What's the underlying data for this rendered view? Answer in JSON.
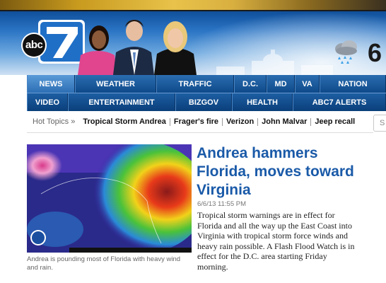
{
  "brand": {
    "logo_text": "abc",
    "logo_number": "7"
  },
  "weather": {
    "icon": "rain-cloud-icon",
    "temperature": "6"
  },
  "nav_primary": [
    {
      "label": "NEWS",
      "active": true
    },
    {
      "label": "WEATHER"
    },
    {
      "label": "TRAFFIC"
    },
    {
      "label": "D.C."
    },
    {
      "label": "MD"
    },
    {
      "label": "VA"
    },
    {
      "label": "NATION"
    }
  ],
  "nav_secondary": [
    {
      "label": "VIDEO"
    },
    {
      "label": "ENTERTAINMENT"
    },
    {
      "label": "BIZGOV"
    },
    {
      "label": "HEALTH"
    },
    {
      "label": "ABC7 ALERTS"
    }
  ],
  "hot_topics": {
    "label": "Hot Topics »",
    "items": [
      "Tropical Storm Andrea",
      "Frager's fire",
      "Verizon",
      "John Malvar",
      "Jeep recall"
    ]
  },
  "search": {
    "placeholder": "S"
  },
  "story": {
    "headline": "Andrea hammers Florida, moves toward Virginia",
    "timestamp": "6/6/13 11:55 PM",
    "summary": "Tropical storm warnings are in effect for Florida and all the way up the East Coast into Virginia with tropical storm force winds and heavy rain possible. A Flash Flood Watch is in effect for the D.C. area starting Friday morning.",
    "caption": "Andrea is pounding most of Florida with heavy wind and rain."
  },
  "colors": {
    "nav_blue": "#0e4a8a",
    "headline_blue": "#1a5aa8",
    "nav_active": "#5a9ad8"
  }
}
